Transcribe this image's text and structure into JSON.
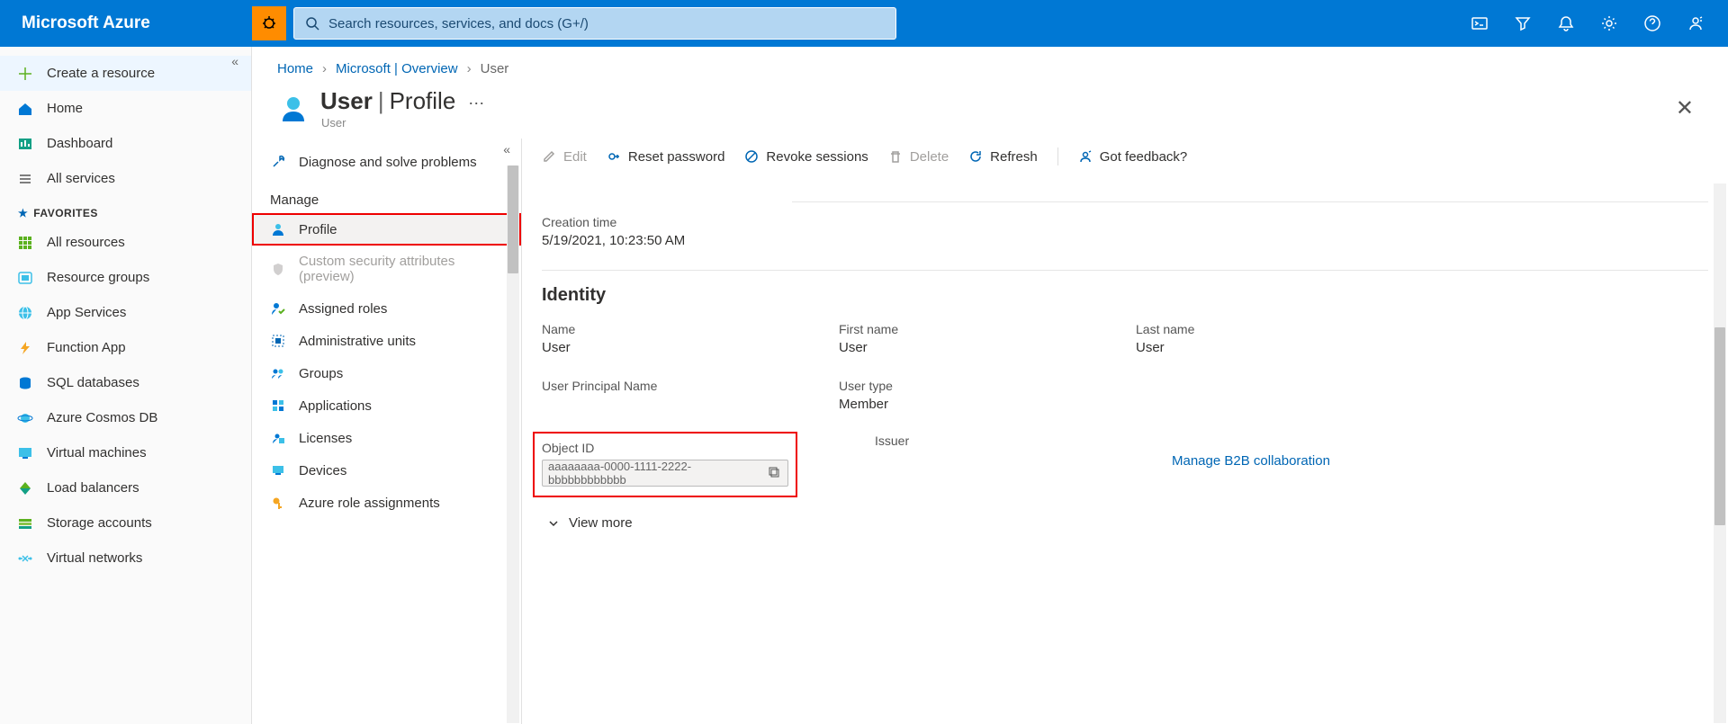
{
  "brand": "Microsoft Azure",
  "search": {
    "placeholder": "Search resources, services, and docs (G+/)"
  },
  "leftnav": {
    "items": [
      {
        "label": "Create a resource"
      },
      {
        "label": "Home"
      },
      {
        "label": "Dashboard"
      },
      {
        "label": "All services"
      }
    ],
    "favorites_label": "FAVORITES",
    "favorites": [
      {
        "label": "All resources"
      },
      {
        "label": "Resource groups"
      },
      {
        "label": "App Services"
      },
      {
        "label": "Function App"
      },
      {
        "label": "SQL databases"
      },
      {
        "label": "Azure Cosmos DB"
      },
      {
        "label": "Virtual machines"
      },
      {
        "label": "Load balancers"
      },
      {
        "label": "Storage accounts"
      },
      {
        "label": "Virtual networks"
      }
    ]
  },
  "breadcrumb": {
    "home": "Home",
    "overview": "Microsoft | Overview",
    "current": "User"
  },
  "page": {
    "title": "User",
    "context": "Profile",
    "subtitle": "User"
  },
  "menu": {
    "diagnose": "Diagnose and solve problems",
    "manage_label": "Manage",
    "items": [
      {
        "label": "Profile"
      },
      {
        "label": "Custom security attributes (preview)"
      },
      {
        "label": "Assigned roles"
      },
      {
        "label": "Administrative units"
      },
      {
        "label": "Groups"
      },
      {
        "label": "Applications"
      },
      {
        "label": "Licenses"
      },
      {
        "label": "Devices"
      },
      {
        "label": "Azure role assignments"
      }
    ]
  },
  "toolbar": {
    "edit": "Edit",
    "reset": "Reset password",
    "revoke": "Revoke sessions",
    "delete": "Delete",
    "refresh": "Refresh",
    "feedback": "Got feedback?"
  },
  "fields": {
    "creation_time_label": "Creation time",
    "creation_time_value": "5/19/2021, 10:23:50 AM",
    "identity_heading": "Identity",
    "name_label": "Name",
    "name_value": "User",
    "first_name_label": "First name",
    "first_name_value": "User",
    "last_name_label": "Last name",
    "last_name_value": "User",
    "upn_label": "User Principal Name",
    "user_type_label": "User type",
    "user_type_value": "Member",
    "object_id_label": "Object ID",
    "object_id_value": "aaaaaaaa-0000-1111-2222-bbbbbbbbbbbb",
    "issuer_label": "Issuer",
    "b2b_link": "Manage B2B collaboration",
    "view_more": "View more"
  }
}
